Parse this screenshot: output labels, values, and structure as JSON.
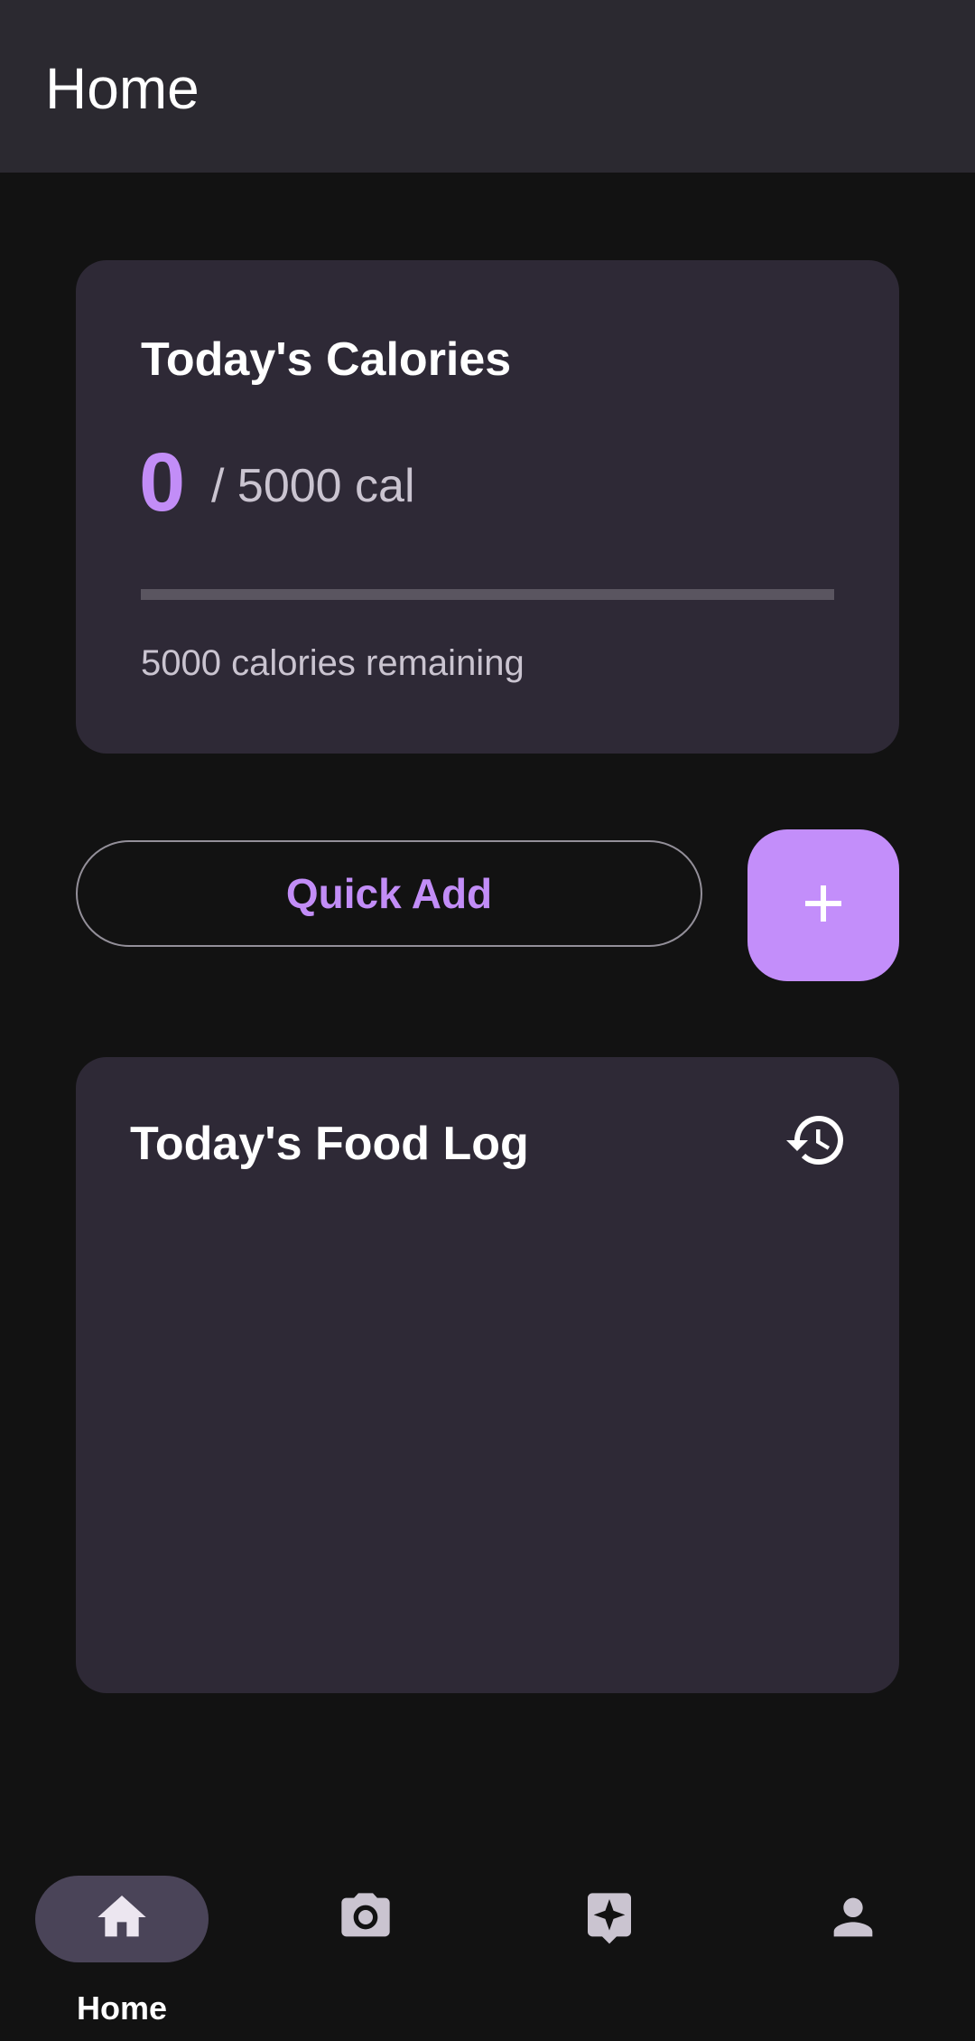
{
  "app_bar": {
    "title": "Home"
  },
  "calories_card": {
    "title": "Today's Calories",
    "consumed": "0",
    "goal_text": "/ 5000 cal",
    "progress_fraction": 0,
    "remaining_text": "5000 calories remaining"
  },
  "actions": {
    "quick_add_label": "Quick Add",
    "add_icon": "plus-icon"
  },
  "food_log": {
    "title": "Today's Food Log",
    "history_icon": "history-icon",
    "items": []
  },
  "bottom_nav": {
    "items": [
      {
        "label": "Home",
        "icon": "home-icon",
        "active": true
      },
      {
        "label": "",
        "icon": "camera-icon",
        "active": false
      },
      {
        "label": "",
        "icon": "sparkle-icon",
        "active": false
      },
      {
        "label": "",
        "icon": "person-icon",
        "active": false
      }
    ]
  },
  "colors": {
    "accent": "#c28df7",
    "surface": "#2e2936",
    "background": "#121212",
    "app_bar": "#2b2930"
  }
}
